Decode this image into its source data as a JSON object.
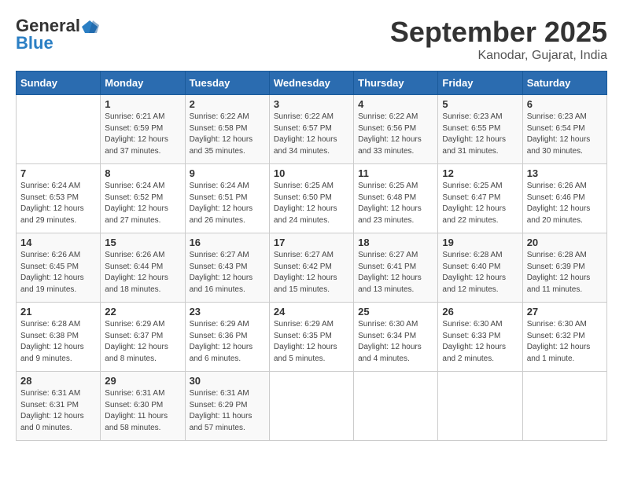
{
  "logo": {
    "line1": "General",
    "line2": "Blue"
  },
  "title": "September 2025",
  "location": "Kanodar, Gujarat, India",
  "weekdays": [
    "Sunday",
    "Monday",
    "Tuesday",
    "Wednesday",
    "Thursday",
    "Friday",
    "Saturday"
  ],
  "weeks": [
    [
      {
        "day": "",
        "content": ""
      },
      {
        "day": "1",
        "content": "Sunrise: 6:21 AM\nSunset: 6:59 PM\nDaylight: 12 hours\nand 37 minutes."
      },
      {
        "day": "2",
        "content": "Sunrise: 6:22 AM\nSunset: 6:58 PM\nDaylight: 12 hours\nand 35 minutes."
      },
      {
        "day": "3",
        "content": "Sunrise: 6:22 AM\nSunset: 6:57 PM\nDaylight: 12 hours\nand 34 minutes."
      },
      {
        "day": "4",
        "content": "Sunrise: 6:22 AM\nSunset: 6:56 PM\nDaylight: 12 hours\nand 33 minutes."
      },
      {
        "day": "5",
        "content": "Sunrise: 6:23 AM\nSunset: 6:55 PM\nDaylight: 12 hours\nand 31 minutes."
      },
      {
        "day": "6",
        "content": "Sunrise: 6:23 AM\nSunset: 6:54 PM\nDaylight: 12 hours\nand 30 minutes."
      }
    ],
    [
      {
        "day": "7",
        "content": "Sunrise: 6:24 AM\nSunset: 6:53 PM\nDaylight: 12 hours\nand 29 minutes."
      },
      {
        "day": "8",
        "content": "Sunrise: 6:24 AM\nSunset: 6:52 PM\nDaylight: 12 hours\nand 27 minutes."
      },
      {
        "day": "9",
        "content": "Sunrise: 6:24 AM\nSunset: 6:51 PM\nDaylight: 12 hours\nand 26 minutes."
      },
      {
        "day": "10",
        "content": "Sunrise: 6:25 AM\nSunset: 6:50 PM\nDaylight: 12 hours\nand 24 minutes."
      },
      {
        "day": "11",
        "content": "Sunrise: 6:25 AM\nSunset: 6:48 PM\nDaylight: 12 hours\nand 23 minutes."
      },
      {
        "day": "12",
        "content": "Sunrise: 6:25 AM\nSunset: 6:47 PM\nDaylight: 12 hours\nand 22 minutes."
      },
      {
        "day": "13",
        "content": "Sunrise: 6:26 AM\nSunset: 6:46 PM\nDaylight: 12 hours\nand 20 minutes."
      }
    ],
    [
      {
        "day": "14",
        "content": "Sunrise: 6:26 AM\nSunset: 6:45 PM\nDaylight: 12 hours\nand 19 minutes."
      },
      {
        "day": "15",
        "content": "Sunrise: 6:26 AM\nSunset: 6:44 PM\nDaylight: 12 hours\nand 18 minutes."
      },
      {
        "day": "16",
        "content": "Sunrise: 6:27 AM\nSunset: 6:43 PM\nDaylight: 12 hours\nand 16 minutes."
      },
      {
        "day": "17",
        "content": "Sunrise: 6:27 AM\nSunset: 6:42 PM\nDaylight: 12 hours\nand 15 minutes."
      },
      {
        "day": "18",
        "content": "Sunrise: 6:27 AM\nSunset: 6:41 PM\nDaylight: 12 hours\nand 13 minutes."
      },
      {
        "day": "19",
        "content": "Sunrise: 6:28 AM\nSunset: 6:40 PM\nDaylight: 12 hours\nand 12 minutes."
      },
      {
        "day": "20",
        "content": "Sunrise: 6:28 AM\nSunset: 6:39 PM\nDaylight: 12 hours\nand 11 minutes."
      }
    ],
    [
      {
        "day": "21",
        "content": "Sunrise: 6:28 AM\nSunset: 6:38 PM\nDaylight: 12 hours\nand 9 minutes."
      },
      {
        "day": "22",
        "content": "Sunrise: 6:29 AM\nSunset: 6:37 PM\nDaylight: 12 hours\nand 8 minutes."
      },
      {
        "day": "23",
        "content": "Sunrise: 6:29 AM\nSunset: 6:36 PM\nDaylight: 12 hours\nand 6 minutes."
      },
      {
        "day": "24",
        "content": "Sunrise: 6:29 AM\nSunset: 6:35 PM\nDaylight: 12 hours\nand 5 minutes."
      },
      {
        "day": "25",
        "content": "Sunrise: 6:30 AM\nSunset: 6:34 PM\nDaylight: 12 hours\nand 4 minutes."
      },
      {
        "day": "26",
        "content": "Sunrise: 6:30 AM\nSunset: 6:33 PM\nDaylight: 12 hours\nand 2 minutes."
      },
      {
        "day": "27",
        "content": "Sunrise: 6:30 AM\nSunset: 6:32 PM\nDaylight: 12 hours\nand 1 minute."
      }
    ],
    [
      {
        "day": "28",
        "content": "Sunrise: 6:31 AM\nSunset: 6:31 PM\nDaylight: 12 hours\nand 0 minutes."
      },
      {
        "day": "29",
        "content": "Sunrise: 6:31 AM\nSunset: 6:30 PM\nDaylight: 11 hours\nand 58 minutes."
      },
      {
        "day": "30",
        "content": "Sunrise: 6:31 AM\nSunset: 6:29 PM\nDaylight: 11 hours\nand 57 minutes."
      },
      {
        "day": "",
        "content": ""
      },
      {
        "day": "",
        "content": ""
      },
      {
        "day": "",
        "content": ""
      },
      {
        "day": "",
        "content": ""
      }
    ]
  ]
}
